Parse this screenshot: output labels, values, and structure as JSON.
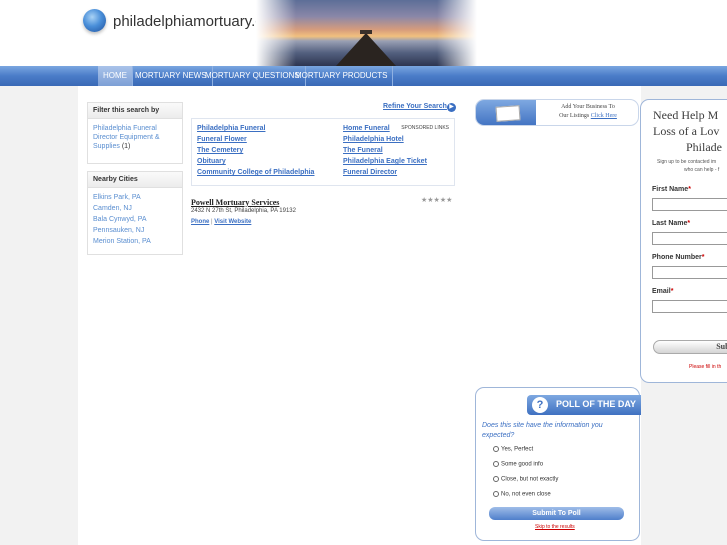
{
  "header": {
    "site_name": "philadelphiamortuary.com"
  },
  "nav": {
    "items": [
      "HOME",
      "MORTUARY NEWS",
      "MORTUARY QUESTIONS",
      "MORTUARY PRODUCTS"
    ]
  },
  "filter": {
    "title": "Filter this search by",
    "item_label": "Philadelphia Funeral Director Equipment & Supplies",
    "item_count": "(1)"
  },
  "nearby": {
    "title": "Nearby Cities",
    "cities": [
      "Elkins Park, PA",
      "Camden, NJ",
      "Bala Cynwyd, PA",
      "Pennsauken, NJ",
      "Merion Station, PA"
    ]
  },
  "refine": {
    "label": "Refine Your Search"
  },
  "sponsored": {
    "label": "SPONSORED LINKS",
    "left_links": [
      "Philadelphia Funeral",
      "Funeral Flower",
      "The Cemetery",
      "Obituary",
      "Community College of Philadelphia"
    ],
    "right_links": [
      "Home Funeral",
      "Philadelphia Hotel",
      "The Funeral",
      "Philadelphia Eagle Ticket",
      "Funeral Director"
    ]
  },
  "listing": {
    "name": "Powell Mortuary Services",
    "stars": "★★★★★",
    "address": "2432 N 27th St, Philadelphia, PA 19132",
    "phone_label": "Phone",
    "separator": "|",
    "website_label": "Visit Website"
  },
  "add_business": {
    "line1": "Add Your Business To",
    "line2": "Our Listings",
    "click": "Click Here"
  },
  "help_form": {
    "title_line1": "Need Help M",
    "title_line2": "Loss of a Lov",
    "title_line3": "Philade",
    "sub_line1": "Sign up to be contacted im",
    "sub_line2": "who can help - f",
    "first_name": "First Name",
    "last_name": "Last Name",
    "phone": "Phone Number",
    "email": "Email",
    "required_mark": "*",
    "submit": "Subn",
    "please_fill": "Please fill in th"
  },
  "poll": {
    "title": "POLL OF THE DAY",
    "question": "Does this site have the information you expected?",
    "options": [
      "Yes, Perfect",
      "Some good info",
      "Close, but not exactly",
      "No, not even close"
    ],
    "submit": "Submit To Poll",
    "skip": "Skip to the results"
  },
  "colors": {
    "nav_blue": "#4a7cc8",
    "link_blue": "#3b6fc2",
    "required_red": "#cc0000"
  }
}
